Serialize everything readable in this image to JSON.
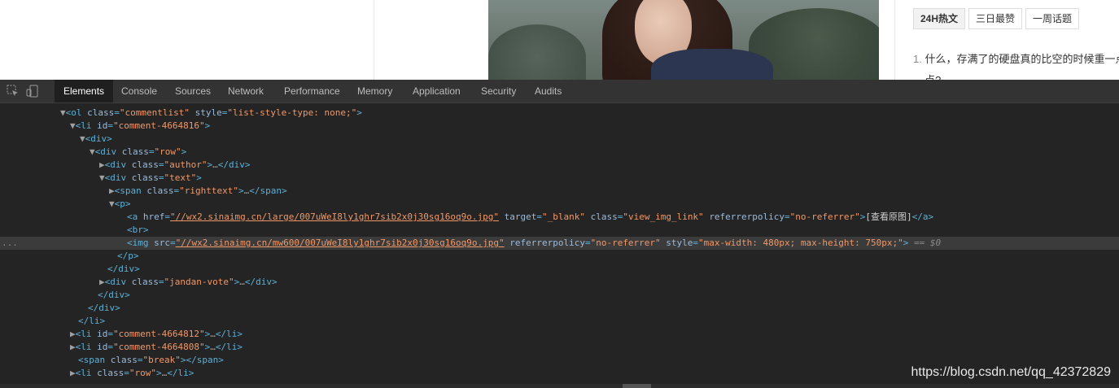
{
  "page": {
    "tabs": [
      "24H热文",
      "三日最赞",
      "一周话题"
    ],
    "hot_item_number": "1.",
    "hot_item_text": "什么，存满了的硬盘真的比空的时候重一点？",
    "hot_item_wrap": "点?"
  },
  "devtools": {
    "tabs": [
      "Elements",
      "Console",
      "Sources",
      "Network",
      "Performance",
      "Memory",
      "Application",
      "Security",
      "Audits"
    ],
    "active_tab": "Elements",
    "lines": {
      "l1": {
        "tag": "<ol",
        "a1": "class",
        "v1": "\"commentlist\"",
        "a2": "style",
        "v2": "\"list-style-type: none;\"",
        "end": ">"
      },
      "l2": {
        "tag": "<li",
        "a1": "id",
        "v1": "\"comment-4664816\"",
        "end": ">"
      },
      "l3": {
        "tag": "<div>"
      },
      "l4": {
        "tag": "<div",
        "a1": "class",
        "v1": "\"row\"",
        "end": ">"
      },
      "l5": {
        "tag": "<div",
        "a1": "class",
        "v1": "\"author\"",
        "end": ">",
        "ell": "…",
        "close": "</div>"
      },
      "l6": {
        "tag": "<div",
        "a1": "class",
        "v1": "\"text\"",
        "end": ">"
      },
      "l7": {
        "tag": "<span",
        "a1": "class",
        "v1": "\"righttext\"",
        "end": ">",
        "ell": "…",
        "close": "</span>"
      },
      "l8": {
        "tag": "<p>"
      },
      "l9": {
        "tag": "<a",
        "a1": "href",
        "v1": "\"//wx2.sinaimg.cn/large/007uWeI8ly1ghr7sib2x0j30sg16oq9o.jpg\"",
        "a2": "target",
        "v2": "\"_blank\"",
        "a3": "class",
        "v3": "\"view_img_link\"",
        "a4": "referrerpolicy",
        "v4": "\"no-referrer\"",
        "end": ">",
        "text": "[查看原图]",
        "close": "</a>"
      },
      "l10": {
        "tag": "<br>"
      },
      "l11": {
        "tag": "<img",
        "a1": "src",
        "v1": "\"//wx2.sinaimg.cn/mw600/007uWeI8ly1ghr7sib2x0j30sg16oq9o.jpg\"",
        "a2": "referrerpolicy",
        "v2": "\"no-referrer\"",
        "a3": "style",
        "v3": "\"max-width: 480px; max-height: 750px;\"",
        "end": ">",
        "marker": "== $0",
        "dots": "..."
      },
      "l12": {
        "tag": "</p>"
      },
      "l13": {
        "tag": "</div>"
      },
      "l14": {
        "tag": "<div",
        "a1": "class",
        "v1": "\"jandan-vote\"",
        "end": ">",
        "ell": "…",
        "close": "</div>"
      },
      "l15": {
        "tag": "</div>"
      },
      "l16": {
        "tag": "</div>"
      },
      "l17": {
        "tag": "</li>"
      },
      "l18": {
        "tag": "<li",
        "a1": "id",
        "v1": "\"comment-4664812\"",
        "end": ">",
        "ell": "…",
        "close": "</li>"
      },
      "l19": {
        "tag": "<li",
        "a1": "id",
        "v1": "\"comment-4664808\"",
        "end": ">",
        "ell": "…",
        "close": "</li>"
      },
      "l20": {
        "tag": "<span",
        "a1": "class",
        "v1": "\"break\"",
        "end": ">",
        "close": "</span>"
      },
      "l21": {
        "tag": "<li",
        "a1": "class",
        "v1": "\"row\"",
        "end": ">",
        "ell": "…",
        "close": "</li>"
      }
    }
  },
  "watermark": "https://blog.csdn.net/qq_42372829"
}
